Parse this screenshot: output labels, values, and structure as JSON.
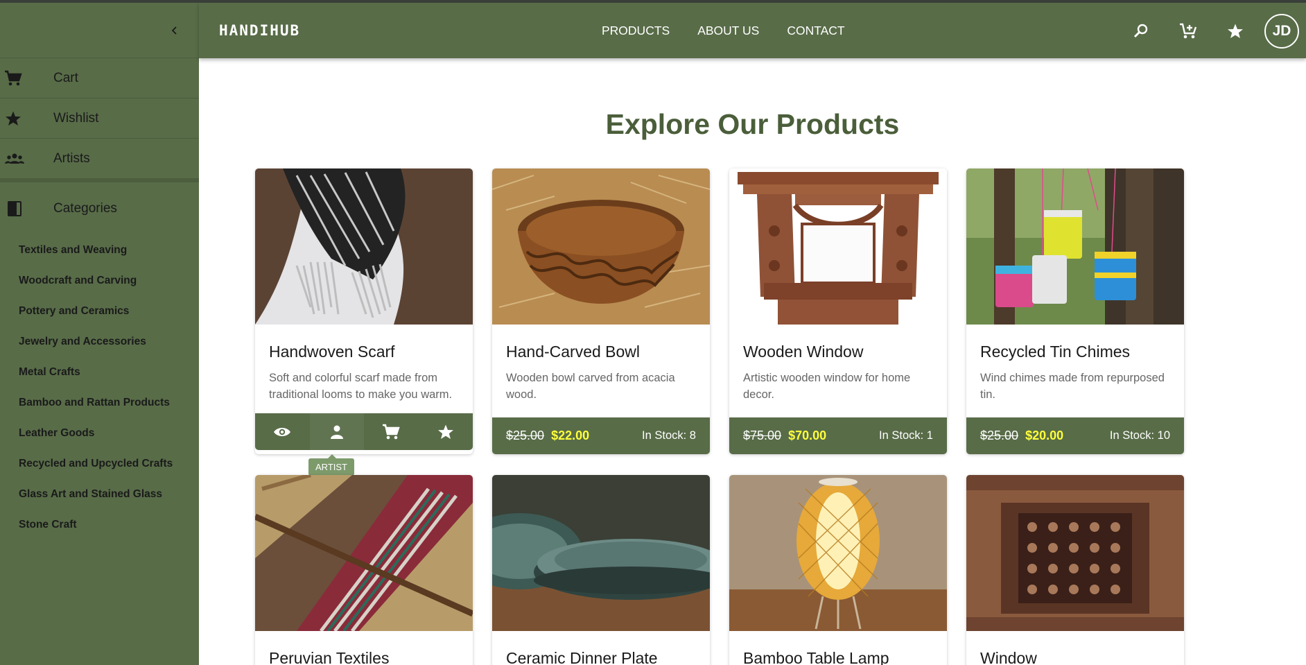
{
  "app": {
    "brand": "HANDIHUB"
  },
  "nav": {
    "items": [
      "PRODUCTS",
      "ABOUT US",
      "CONTACT"
    ]
  },
  "user": {
    "initials": "JD"
  },
  "sidebar": {
    "items": [
      {
        "label": "Cart",
        "icon": "cart-icon"
      },
      {
        "label": "Wishlist",
        "icon": "star-icon"
      },
      {
        "label": "Artists",
        "icon": "group-icon"
      }
    ],
    "categories_label": "Categories",
    "categories": [
      "Textiles and Weaving",
      "Woodcraft and Carving",
      "Pottery and Ceramics",
      "Jewelry and Accessories",
      "Metal Crafts",
      "Bamboo and Rattan Products",
      "Leather Goods",
      "Recycled and Upcycled Crafts",
      "Glass Art and Stained Glass",
      "Stone Craft"
    ]
  },
  "main": {
    "title": "Explore Our Products",
    "products": [
      {
        "name": "Handwoven Scarf",
        "desc": "Soft and colorful scarf made from traditional looms to make you warm.",
        "tooltip": "ARTIST"
      },
      {
        "name": "Hand-Carved Bowl",
        "desc": "Wooden bowl carved from acacia wood.",
        "old_price": "$25.00",
        "price": "$22.00",
        "stock": "In Stock: 8"
      },
      {
        "name": "Wooden Window",
        "desc": "Artistic wooden window for home decor.",
        "old_price": "$75.00",
        "price": "$70.00",
        "stock": "In Stock: 1"
      },
      {
        "name": "Recycled Tin Chimes",
        "desc": "Wind chimes made from repurposed tin.",
        "old_price": "$25.00",
        "price": "$20.00",
        "stock": "In Stock: 10"
      },
      {
        "name": "Peruvian Textiles"
      },
      {
        "name": "Ceramic Dinner Plate"
      },
      {
        "name": "Bamboo Table Lamp"
      },
      {
        "name": "Window"
      }
    ]
  },
  "colors": {
    "primary": "#586c48",
    "sale_price": "#ffff3a",
    "title": "#4a5e3a"
  }
}
